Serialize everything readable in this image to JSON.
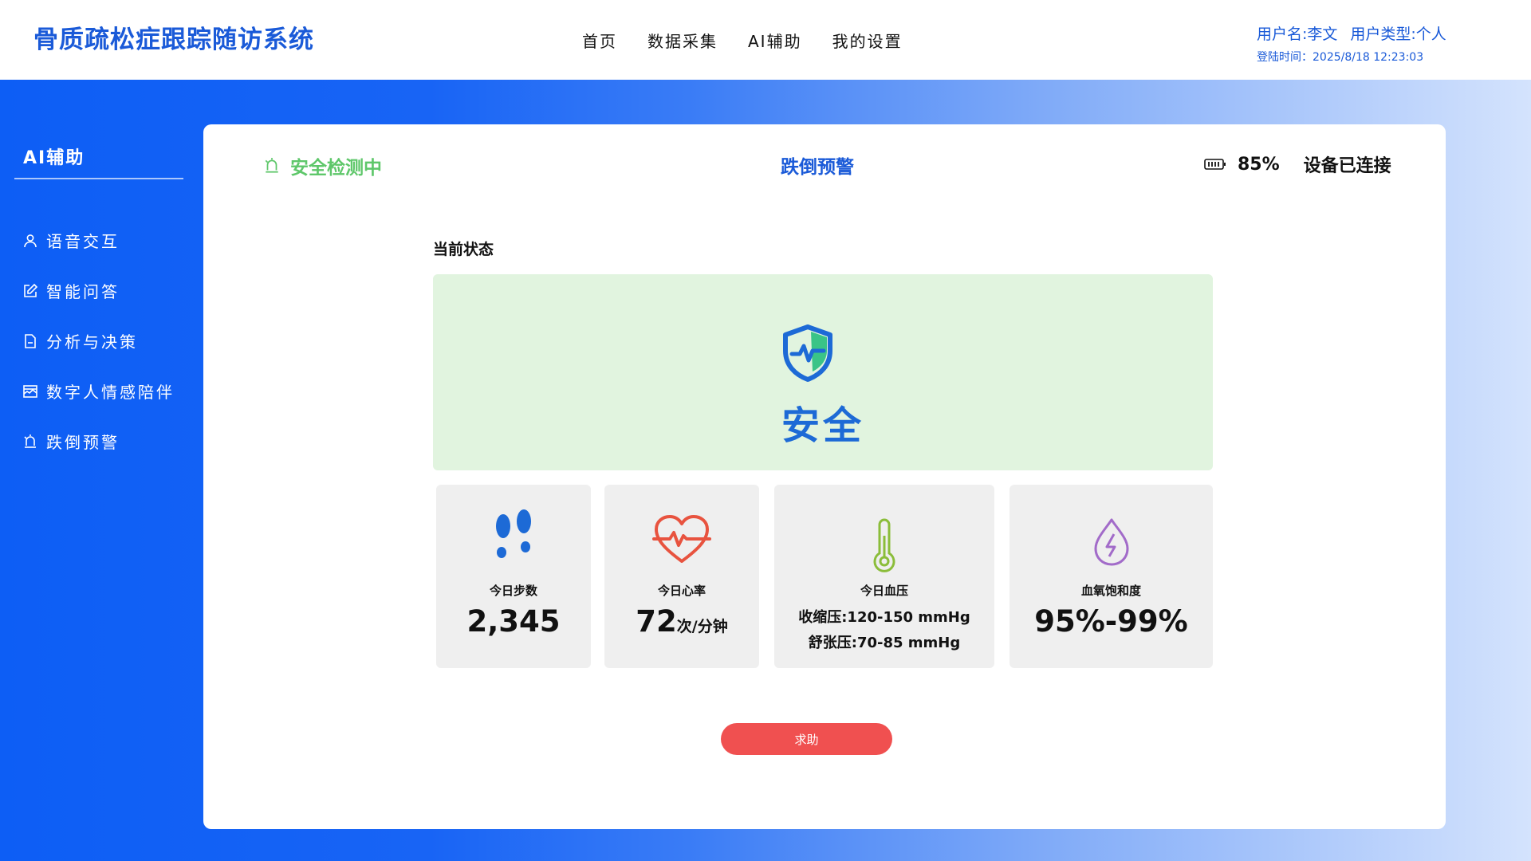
{
  "header": {
    "app_title": "骨质疏松症跟踪随访系统",
    "nav": [
      "首页",
      "数据采集",
      "AI辅助",
      "我的设置"
    ],
    "username": "用户名:李文",
    "user_type": "用户类型:个人",
    "login_time": "登陆时间：2025/8/18 12:23:03"
  },
  "sidebar": {
    "title": "AI辅助",
    "items": [
      {
        "label": "语音交互",
        "icon": "user-icon"
      },
      {
        "label": "智能问答",
        "icon": "edit-icon"
      },
      {
        "label": "分析与决策",
        "icon": "document-icon"
      },
      {
        "label": "数字人情感陪伴",
        "icon": "image-icon"
      },
      {
        "label": "跌倒预警",
        "icon": "alarm-icon"
      }
    ]
  },
  "main": {
    "monitor_status": "安全检测中",
    "title": "跌倒预警",
    "battery": "85%",
    "device_status": "设备已连接",
    "current_state_label": "当前状态",
    "state": "安全",
    "metrics": {
      "steps": {
        "label": "今日步数",
        "value": "2,345"
      },
      "heart_rate": {
        "label": "今日心率",
        "value": "72",
        "unit": "次/分钟"
      },
      "blood_pressure": {
        "label": "今日血压",
        "systolic": "收缩压:120-150 mmHg",
        "diastolic": "舒张压:70-85 mmHg"
      },
      "spo2": {
        "label": "血氧饱和度",
        "value": "95%-99%"
      }
    },
    "help_button": "求助"
  },
  "colors": {
    "brand_blue": "#1a5ad8",
    "safe_green": "#5ec76a",
    "safe_panel_bg": "#e1f4df",
    "help_red": "#f05050",
    "heart_red": "#e8533f",
    "thermo_green": "#8bbd3a",
    "drop_purple": "#a26bc9"
  }
}
